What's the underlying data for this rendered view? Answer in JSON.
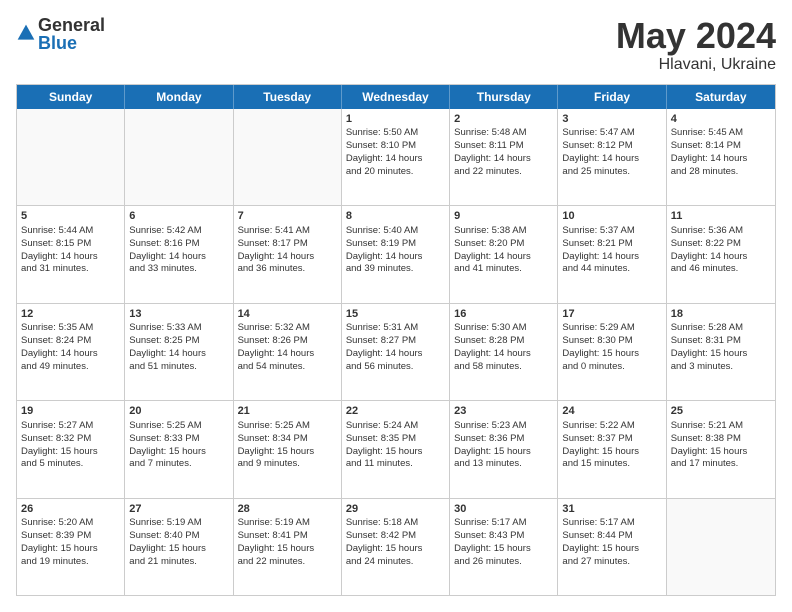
{
  "logo": {
    "general": "General",
    "blue": "Blue"
  },
  "header": {
    "month": "May 2024",
    "location": "Hlavani, Ukraine"
  },
  "weekdays": [
    "Sunday",
    "Monday",
    "Tuesday",
    "Wednesday",
    "Thursday",
    "Friday",
    "Saturday"
  ],
  "rows": [
    [
      {
        "day": "",
        "info": "",
        "empty": true
      },
      {
        "day": "",
        "info": "",
        "empty": true
      },
      {
        "day": "",
        "info": "",
        "empty": true
      },
      {
        "day": "1",
        "info": "Sunrise: 5:50 AM\nSunset: 8:10 PM\nDaylight: 14 hours\nand 20 minutes."
      },
      {
        "day": "2",
        "info": "Sunrise: 5:48 AM\nSunset: 8:11 PM\nDaylight: 14 hours\nand 22 minutes."
      },
      {
        "day": "3",
        "info": "Sunrise: 5:47 AM\nSunset: 8:12 PM\nDaylight: 14 hours\nand 25 minutes."
      },
      {
        "day": "4",
        "info": "Sunrise: 5:45 AM\nSunset: 8:14 PM\nDaylight: 14 hours\nand 28 minutes."
      }
    ],
    [
      {
        "day": "5",
        "info": "Sunrise: 5:44 AM\nSunset: 8:15 PM\nDaylight: 14 hours\nand 31 minutes."
      },
      {
        "day": "6",
        "info": "Sunrise: 5:42 AM\nSunset: 8:16 PM\nDaylight: 14 hours\nand 33 minutes."
      },
      {
        "day": "7",
        "info": "Sunrise: 5:41 AM\nSunset: 8:17 PM\nDaylight: 14 hours\nand 36 minutes."
      },
      {
        "day": "8",
        "info": "Sunrise: 5:40 AM\nSunset: 8:19 PM\nDaylight: 14 hours\nand 39 minutes."
      },
      {
        "day": "9",
        "info": "Sunrise: 5:38 AM\nSunset: 8:20 PM\nDaylight: 14 hours\nand 41 minutes."
      },
      {
        "day": "10",
        "info": "Sunrise: 5:37 AM\nSunset: 8:21 PM\nDaylight: 14 hours\nand 44 minutes."
      },
      {
        "day": "11",
        "info": "Sunrise: 5:36 AM\nSunset: 8:22 PM\nDaylight: 14 hours\nand 46 minutes."
      }
    ],
    [
      {
        "day": "12",
        "info": "Sunrise: 5:35 AM\nSunset: 8:24 PM\nDaylight: 14 hours\nand 49 minutes."
      },
      {
        "day": "13",
        "info": "Sunrise: 5:33 AM\nSunset: 8:25 PM\nDaylight: 14 hours\nand 51 minutes."
      },
      {
        "day": "14",
        "info": "Sunrise: 5:32 AM\nSunset: 8:26 PM\nDaylight: 14 hours\nand 54 minutes."
      },
      {
        "day": "15",
        "info": "Sunrise: 5:31 AM\nSunset: 8:27 PM\nDaylight: 14 hours\nand 56 minutes."
      },
      {
        "day": "16",
        "info": "Sunrise: 5:30 AM\nSunset: 8:28 PM\nDaylight: 14 hours\nand 58 minutes."
      },
      {
        "day": "17",
        "info": "Sunrise: 5:29 AM\nSunset: 8:30 PM\nDaylight: 15 hours\nand 0 minutes."
      },
      {
        "day": "18",
        "info": "Sunrise: 5:28 AM\nSunset: 8:31 PM\nDaylight: 15 hours\nand 3 minutes."
      }
    ],
    [
      {
        "day": "19",
        "info": "Sunrise: 5:27 AM\nSunset: 8:32 PM\nDaylight: 15 hours\nand 5 minutes."
      },
      {
        "day": "20",
        "info": "Sunrise: 5:25 AM\nSunset: 8:33 PM\nDaylight: 15 hours\nand 7 minutes."
      },
      {
        "day": "21",
        "info": "Sunrise: 5:25 AM\nSunset: 8:34 PM\nDaylight: 15 hours\nand 9 minutes."
      },
      {
        "day": "22",
        "info": "Sunrise: 5:24 AM\nSunset: 8:35 PM\nDaylight: 15 hours\nand 11 minutes."
      },
      {
        "day": "23",
        "info": "Sunrise: 5:23 AM\nSunset: 8:36 PM\nDaylight: 15 hours\nand 13 minutes."
      },
      {
        "day": "24",
        "info": "Sunrise: 5:22 AM\nSunset: 8:37 PM\nDaylight: 15 hours\nand 15 minutes."
      },
      {
        "day": "25",
        "info": "Sunrise: 5:21 AM\nSunset: 8:38 PM\nDaylight: 15 hours\nand 17 minutes."
      }
    ],
    [
      {
        "day": "26",
        "info": "Sunrise: 5:20 AM\nSunset: 8:39 PM\nDaylight: 15 hours\nand 19 minutes."
      },
      {
        "day": "27",
        "info": "Sunrise: 5:19 AM\nSunset: 8:40 PM\nDaylight: 15 hours\nand 21 minutes."
      },
      {
        "day": "28",
        "info": "Sunrise: 5:19 AM\nSunset: 8:41 PM\nDaylight: 15 hours\nand 22 minutes."
      },
      {
        "day": "29",
        "info": "Sunrise: 5:18 AM\nSunset: 8:42 PM\nDaylight: 15 hours\nand 24 minutes."
      },
      {
        "day": "30",
        "info": "Sunrise: 5:17 AM\nSunset: 8:43 PM\nDaylight: 15 hours\nand 26 minutes."
      },
      {
        "day": "31",
        "info": "Sunrise: 5:17 AM\nSunset: 8:44 PM\nDaylight: 15 hours\nand 27 minutes."
      },
      {
        "day": "",
        "info": "",
        "empty": true
      }
    ]
  ]
}
